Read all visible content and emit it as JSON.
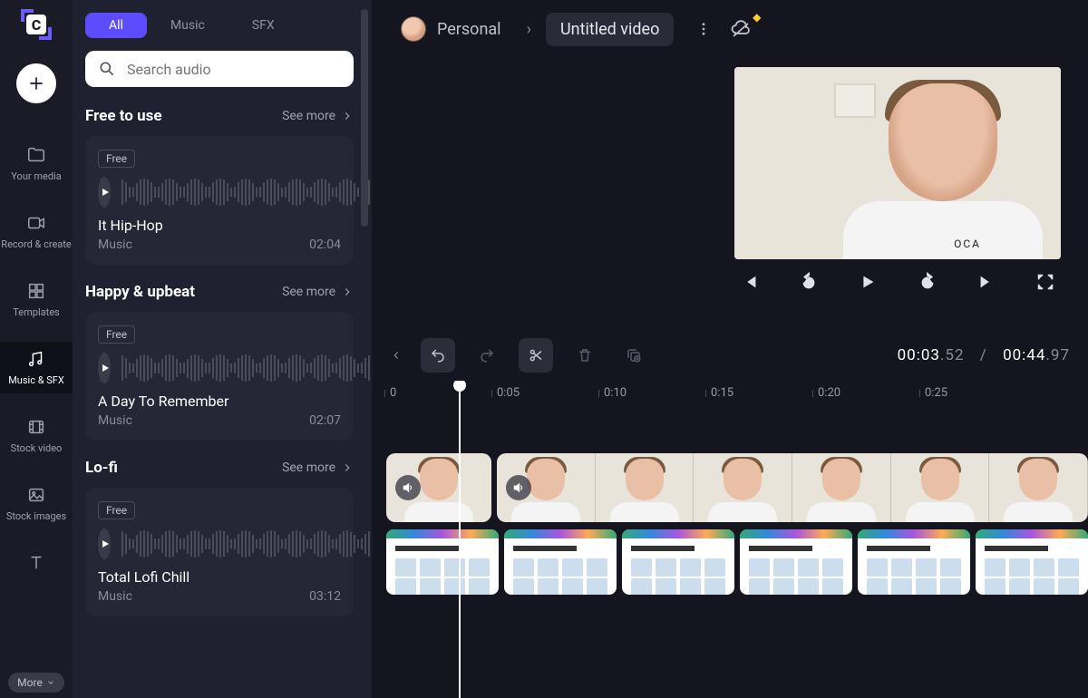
{
  "rail": {
    "items": [
      {
        "label": "Your media"
      },
      {
        "label": "Record & create"
      },
      {
        "label": "Templates"
      },
      {
        "label": "Music & SFX"
      },
      {
        "label": "Stock video"
      },
      {
        "label": "Stock images"
      }
    ],
    "more": "More"
  },
  "panel": {
    "tabs": {
      "all": "All",
      "music": "Music",
      "sfx": "SFX"
    },
    "search_placeholder": "Search audio",
    "see_more": "See more",
    "badge": "Free",
    "sections": [
      {
        "title": "Free to use",
        "track": {
          "title": "It Hip-Hop",
          "category": "Music",
          "duration": "02:04"
        }
      },
      {
        "title": "Happy & upbeat",
        "track": {
          "title": "A Day To Remember",
          "category": "Music",
          "duration": "02:07"
        }
      },
      {
        "title": "Lo-fi",
        "track": {
          "title": "Total Lofi Chill",
          "category": "Music",
          "duration": "03:12"
        }
      }
    ]
  },
  "top": {
    "workspace": "Personal",
    "title": "Untitled video"
  },
  "time": {
    "current_main": "00:03",
    "current_frac": ".52",
    "sep": "/",
    "total_main": "00:44",
    "total_frac": ".97"
  },
  "ruler": [
    "0",
    "0:05",
    "0:10",
    "0:15",
    "0:20",
    "0:25"
  ],
  "preview_text": "OCA"
}
